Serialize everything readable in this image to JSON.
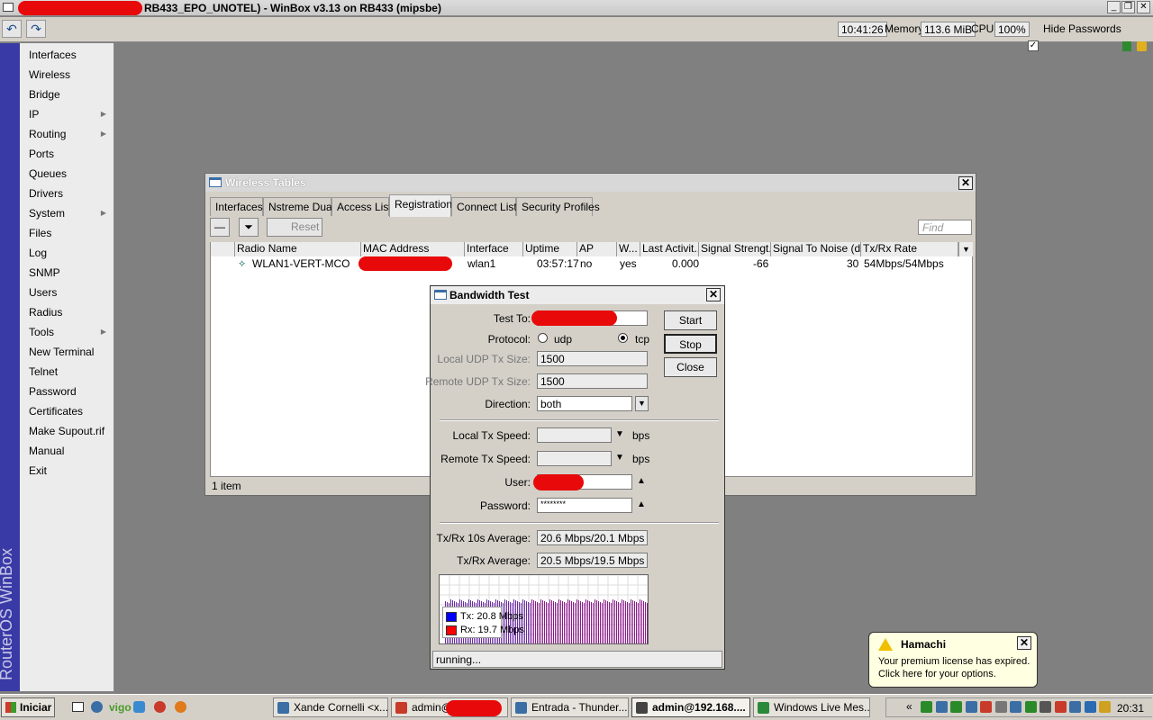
{
  "window": {
    "title": "RB433_EPO_UNOTEL) - WinBox v3.13 on RB433 (mipsbe)"
  },
  "toolbar": {
    "time": "10:41:26",
    "memory_label": "Memory:",
    "memory": "113.6 MiB",
    "cpu_label": "CPU:",
    "cpu": "100%",
    "hide_passwords": "Hide Passwords",
    "hide_passwords_checked": true
  },
  "sidebar": {
    "brand": "RouterOS WinBox",
    "items": [
      {
        "label": "Interfaces",
        "submenu": false
      },
      {
        "label": "Wireless",
        "submenu": false
      },
      {
        "label": "Bridge",
        "submenu": false
      },
      {
        "label": "IP",
        "submenu": true
      },
      {
        "label": "Routing",
        "submenu": true
      },
      {
        "label": "Ports",
        "submenu": false
      },
      {
        "label": "Queues",
        "submenu": false
      },
      {
        "label": "Drivers",
        "submenu": false
      },
      {
        "label": "System",
        "submenu": true
      },
      {
        "label": "Files",
        "submenu": false
      },
      {
        "label": "Log",
        "submenu": false
      },
      {
        "label": "SNMP",
        "submenu": false
      },
      {
        "label": "Users",
        "submenu": false
      },
      {
        "label": "Radius",
        "submenu": false
      },
      {
        "label": "Tools",
        "submenu": true
      },
      {
        "label": "New Terminal",
        "submenu": false
      },
      {
        "label": "Telnet",
        "submenu": false
      },
      {
        "label": "Password",
        "submenu": false
      },
      {
        "label": "Certificates",
        "submenu": false
      },
      {
        "label": "Make Supout.rif",
        "submenu": false
      },
      {
        "label": "Manual",
        "submenu": false
      },
      {
        "label": "Exit",
        "submenu": false
      }
    ]
  },
  "wireless_tables": {
    "title": "Wireless Tables",
    "tabs": [
      "Interfaces",
      "Nstreme Dual",
      "Access List",
      "Registration",
      "Connect List",
      "Security Profiles"
    ],
    "active_tab": "Registration",
    "reset_label": "Reset",
    "find_placeholder": "Find",
    "columns": [
      "Radio Name",
      "MAC Address",
      "Interface",
      "Uptime",
      "AP",
      "W...",
      "Last Activit...",
      "Signal Strengt...",
      "Signal To Noise (d...",
      "Tx/Rx Rate"
    ],
    "rows": [
      {
        "radio_name": "WLAN1-VERT-MCO",
        "mac": "",
        "interface": "wlan1",
        "uptime": "03:57:17",
        "ap": "no",
        "w": "yes",
        "last_activity": "0.000",
        "signal": "-66",
        "snr": "30",
        "rate": "54Mbps/54Mbps"
      }
    ],
    "status": "1 item"
  },
  "bandwidth_test": {
    "title": "Bandwidth Test",
    "test_to_label": "Test To:",
    "protocol_label": "Protocol:",
    "protocol_udp": "udp",
    "protocol_tcp": "tcp",
    "protocol_selected": "tcp",
    "local_udp_label": "Local UDP Tx Size:",
    "local_udp": "1500",
    "remote_udp_label": "Remote UDP Tx Size:",
    "remote_udp": "1500",
    "direction_label": "Direction:",
    "direction": "both",
    "local_tx_label": "Local Tx Speed:",
    "remote_tx_label": "Remote Tx Speed:",
    "bps": "bps",
    "user_label": "User:",
    "password_label": "Password:",
    "password": "********",
    "avg10_label": "Tx/Rx 10s Average:",
    "avg10": "20.6 Mbps/20.1 Mbps",
    "avg_label": "Tx/Rx Average:",
    "avg": "20.5 Mbps/19.5 Mbps",
    "legend_tx": "Tx:  20.8 Mbps",
    "legend_rx": "Rx:  19.7 Mbps",
    "start": "Start",
    "stop": "Stop",
    "close": "Close",
    "status": "running...",
    "tx_color": "#0000ff",
    "rx_color": "#ff0000"
  },
  "hamachi": {
    "title": "Hamachi",
    "message_line1": "Your premium license has expired.",
    "message_line2": "Click here for your options."
  },
  "taskbar": {
    "start": "Iniciar",
    "tasks": [
      "Xande Cornelli <x...",
      "admin@",
      "Entrada - Thunder...",
      "admin@192.168....",
      "Windows Live Mes..."
    ],
    "active_task": "admin@192.168....",
    "clock": "20:31"
  }
}
